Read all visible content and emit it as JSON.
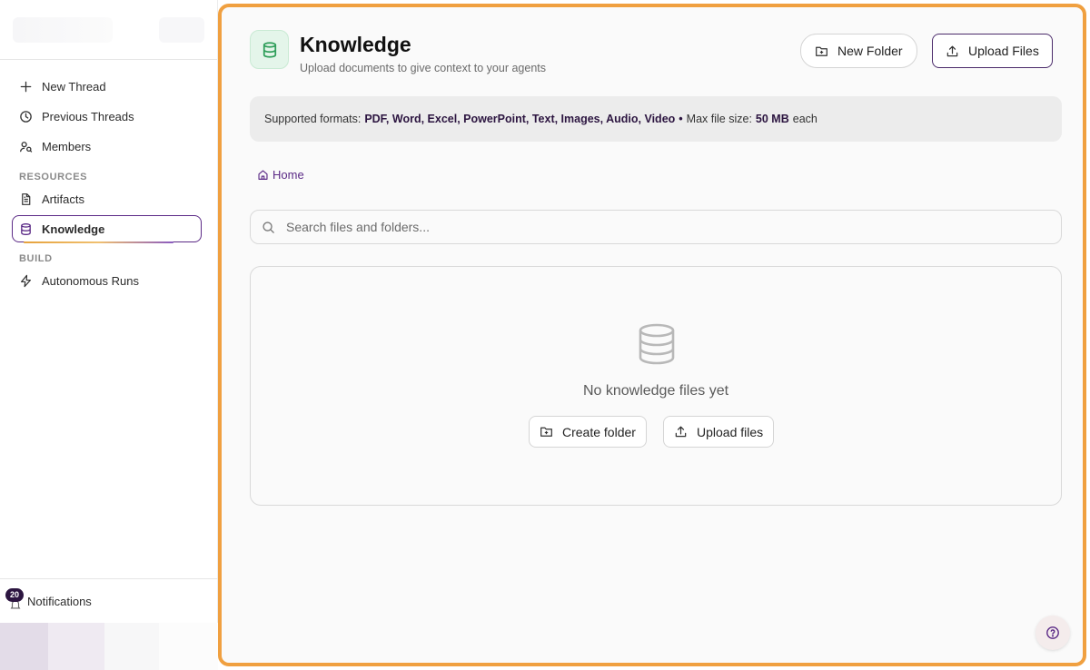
{
  "sidebar": {
    "nav": [
      {
        "label": "New Thread",
        "icon": "plus-icon"
      },
      {
        "label": "Previous Threads",
        "icon": "clock-icon"
      },
      {
        "label": "Members",
        "icon": "users-icon"
      }
    ],
    "resources_label": "RESOURCES",
    "resources": [
      {
        "label": "Artifacts",
        "icon": "file-text-icon"
      },
      {
        "label": "Knowledge",
        "icon": "database-icon",
        "active": true
      }
    ],
    "build_label": "BUILD",
    "build": [
      {
        "label": "Autonomous Runs",
        "icon": "zap-icon"
      }
    ],
    "notifications": {
      "label": "Notifications",
      "count": "20"
    }
  },
  "header": {
    "title": "Knowledge",
    "subtitle": "Upload documents to give context to your agents",
    "new_folder_label": "New Folder",
    "upload_files_label": "Upload Files"
  },
  "formats": {
    "prefix": "Supported formats:",
    "list": "PDF, Word, Excel, PowerPoint, Text, Images, Audio, Video",
    "separator": "•",
    "size_prefix": "Max file size:",
    "size": "50 MB",
    "size_suffix": "each"
  },
  "breadcrumb": {
    "home": "Home"
  },
  "search": {
    "placeholder": "Search files and folders..."
  },
  "empty": {
    "message": "No knowledge files yet",
    "create_folder_label": "Create folder",
    "upload_files_label": "Upload files"
  },
  "colors": {
    "accent": "#5b2a86",
    "highlight_border": "#f0a040",
    "icon_green": "#2f9e5a"
  }
}
